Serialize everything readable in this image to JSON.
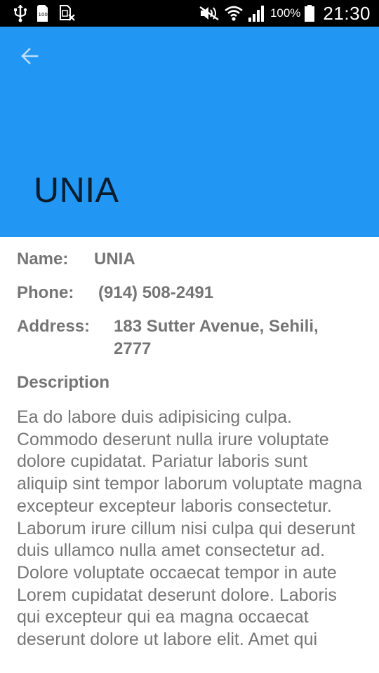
{
  "status_bar": {
    "battery_percent": "100%",
    "time": "21:30",
    "icons": [
      "usb-icon",
      "storage-icon",
      "no-sim-icon",
      "mute-icon",
      "wifi-icon",
      "signal-icon",
      "battery-icon"
    ]
  },
  "app_bar": {
    "title": "UNIA",
    "color": "#2196F3",
    "back_icon": "arrow-back-icon"
  },
  "details": {
    "name_label": "Name:",
    "name_value": "UNIA",
    "phone_label": "Phone:",
    "phone_value": "(914) 508-2491",
    "address_label": "Address:",
    "address_value": "183 Sutter Avenue, Sehili, 2777",
    "description_heading": "Description",
    "description_text": "Ea do labore duis adipisicing culpa. Commodo deserunt nulla irure voluptate dolore cupidatat. Pariatur laboris sunt aliquip sint tempor laborum voluptate magna excepteur excepteur laboris consectetur. Laborum irure cillum nisi culpa qui deserunt duis ullamco nulla amet consectetur ad. Dolore voluptate occaecat tempor in aute Lorem cupidatat deserunt dolore. Laboris qui excepteur qui ea magna occaecat deserunt dolore ut labore elit. Amet qui"
  }
}
